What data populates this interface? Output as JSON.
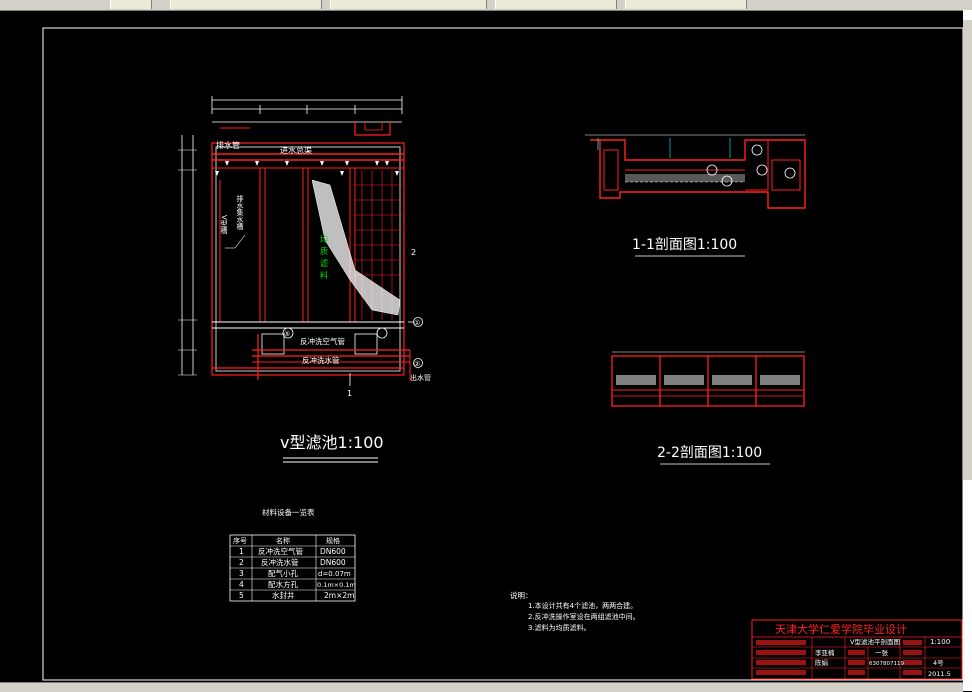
{
  "sections": {
    "plan_title": "v型滤池1:100",
    "section1_title": "1-1剖面图1:100",
    "section2_title": "2-2剖面图1:100"
  },
  "plan_labels": {
    "inlet_header": "进水总渠",
    "drain_pipe": "排水管",
    "collector": "排水集水槽",
    "v_trough": "V型槽",
    "media": [
      "均",
      "质",
      "滤",
      "料"
    ],
    "air_pipe": "反冲洗空气管",
    "water_pipe": "反冲洗水管",
    "outlet": "出水管",
    "cut1": "1",
    "cut2": "2",
    "circle1": "①",
    "circle2": "②",
    "circle5": "⑤"
  },
  "material_table": {
    "title": "材料设备一览表",
    "headers": [
      "序号",
      "名称",
      "规格"
    ],
    "rows": [
      [
        "1",
        "反冲洗空气管",
        "DN600"
      ],
      [
        "2",
        "反冲洗水管",
        "DN600"
      ],
      [
        "3",
        "配气小孔",
        "d=0.07m"
      ],
      [
        "4",
        "配水方孔",
        "0.1m×0.1m"
      ],
      [
        "5",
        "水封井",
        "2m×2m"
      ]
    ]
  },
  "notes": {
    "heading": "说明：",
    "lines": [
      "1.本设计共有4个滤池，两两合建。",
      "2.反冲洗操作室设在两组滤池中间。",
      "3.滤料为均质滤料。"
    ]
  },
  "title_block": {
    "school": "天津大学仁爱学院毕业设计",
    "drawing_name": "V型滤池平剖面图",
    "scale": "1:100",
    "designer": "李亚楠",
    "reviewer": "陈娟",
    "sheet": "一张",
    "number": "4号",
    "student_id": "6307807119",
    "date": "2011.5"
  },
  "colors": {
    "frame": "#ffffff",
    "red": "#ff2020",
    "green": "#00e000",
    "cyan": "#00ffff"
  }
}
